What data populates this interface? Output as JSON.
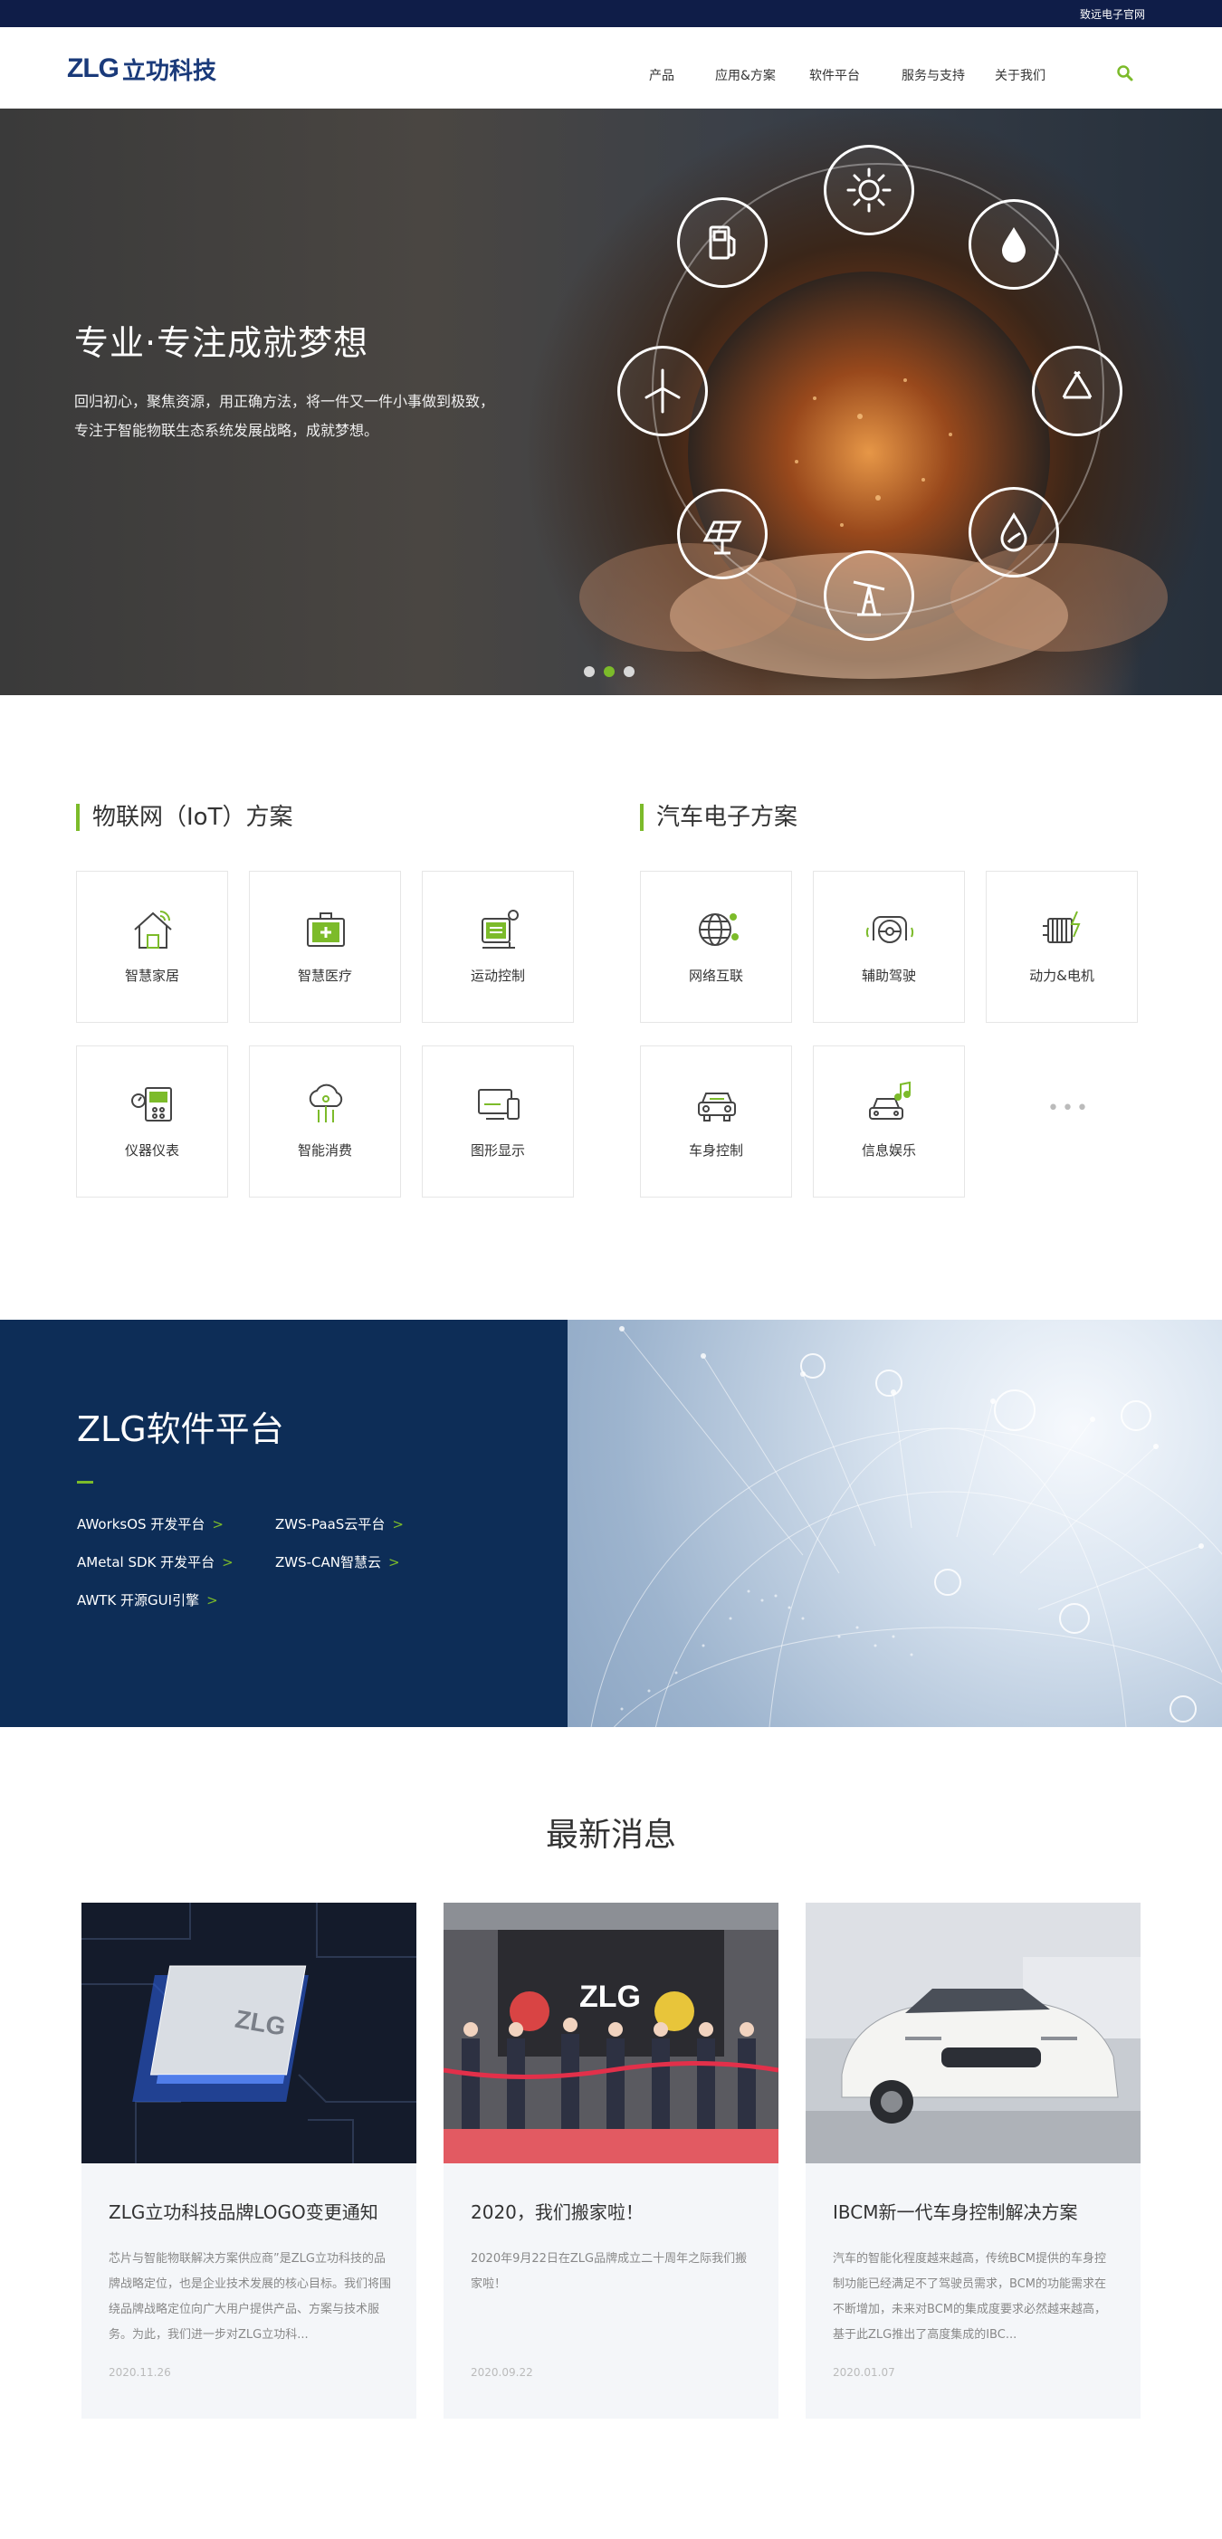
{
  "topbar": {
    "link": "致远电子官网"
  },
  "header": {
    "logo_text": "ZLG",
    "logo_cn": "立功科技",
    "nav": [
      {
        "label": "产品"
      },
      {
        "label": "应用&方案"
      },
      {
        "label": "软件平台"
      },
      {
        "label": "服务与支持"
      },
      {
        "label": "关于我们"
      }
    ],
    "search_icon": "search-icon"
  },
  "hero": {
    "title": "专业·专注成就梦想",
    "desc_line1": "回归初心，聚焦资源，用正确方法，将一件又一件小事做到极致，",
    "desc_line2": "专注于智能物联生态系统发展战略，成就梦想。",
    "slides": 3,
    "active_slide": 2,
    "icons": [
      "fuel-pump-icon",
      "sun-icon",
      "water-drop-icon",
      "wind-turbine-icon",
      "recycle-icon",
      "solar-panel-icon",
      "oil-pump-icon",
      "leaf-drop-icon"
    ]
  },
  "iot": {
    "title": "物联网（IoT）方案",
    "items": [
      {
        "label": "智慧家居",
        "icon": "smart-home-icon"
      },
      {
        "label": "智慧医疗",
        "icon": "medical-kit-icon"
      },
      {
        "label": "运动控制",
        "icon": "motion-control-icon"
      },
      {
        "label": "仪器仪表",
        "icon": "instrument-icon"
      },
      {
        "label": "智能消费",
        "icon": "cloud-consumer-icon"
      },
      {
        "label": "图形显示",
        "icon": "display-devices-icon"
      }
    ]
  },
  "auto": {
    "title": "汽车电子方案",
    "items": [
      {
        "label": "网络互联",
        "icon": "network-globe-icon"
      },
      {
        "label": "辅助驾驶",
        "icon": "steering-wheel-icon"
      },
      {
        "label": "动力&电机",
        "icon": "battery-motor-icon"
      },
      {
        "label": "车身控制",
        "icon": "car-body-icon"
      },
      {
        "label": "信息娱乐",
        "icon": "car-music-icon"
      }
    ],
    "more": "•••"
  },
  "software": {
    "title": "ZLG软件平台",
    "arrow": ">",
    "links": [
      {
        "label": "AWorksOS 开发平台"
      },
      {
        "label": "ZWS-PaaS云平台"
      },
      {
        "label": "AMetal SDK 开发平台"
      },
      {
        "label": "ZWS-CAN智慧云"
      },
      {
        "label": "AWTK 开源GUI引擎"
      }
    ]
  },
  "news": {
    "heading": "最新消息",
    "items": [
      {
        "title": "ZLG立功科技品牌LOGO变更通知",
        "desc": "芯片与智能物联解决方案供应商”是ZLG立功科技的品牌战略定位，也是企业技术发展的核心目标。我们将围绕品牌战略定位向广大用户提供产品、方案与技术服务。为此，我们进一步对ZLG立功科...",
        "date": "2020.11.26"
      },
      {
        "title": "2020，我们搬家啦！",
        "desc": "2020年9月22日在ZLG品牌成立二十周年之际我们搬家啦！",
        "date": "2020.09.22"
      },
      {
        "title": "IBCM新一代车身控制解决方案",
        "desc": "汽车的智能化程度越来越高，传统BCM提供的车身控制功能已经满足不了驾驶员需求，BCM的功能需求在不断增加，未来对BCM的集成度要求必然越来越高，基于此ZLG推出了高度集成的IBC...",
        "date": "2020.01.07"
      }
    ]
  },
  "colors": {
    "navy": "#0f1d48",
    "brand_blue": "#1a3a7a",
    "accent_green": "#7cbb2a",
    "software_bg": "#0d2d57"
  }
}
